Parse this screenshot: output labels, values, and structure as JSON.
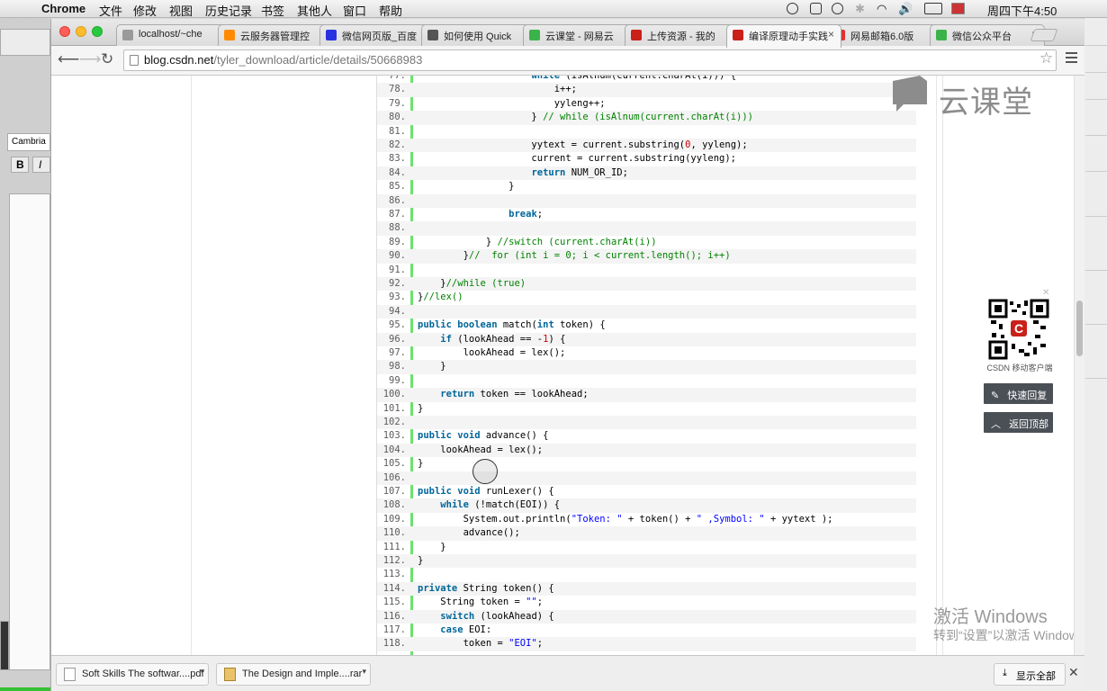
{
  "menubar": {
    "app": "Chrome",
    "items": [
      "文件",
      "修改",
      "视图",
      "历史记录",
      "书签",
      "其他人",
      "窗口",
      "帮助"
    ],
    "clock": "周四下午4:50"
  },
  "tabs": [
    {
      "label": "localhost/~che",
      "color": "#9a9a9a",
      "active": false
    },
    {
      "label": "云服务器管理控",
      "color": "#ff8a00",
      "active": false
    },
    {
      "label": "微信网页版_百度",
      "color": "#2932e1",
      "active": false
    },
    {
      "label": "如何使用 Quick",
      "color": "#555555",
      "active": false
    },
    {
      "label": "云课堂 - 网易云",
      "color": "#3cb34a",
      "active": false
    },
    {
      "label": "上传资源 - 我的",
      "color": "#c9201a",
      "active": false
    },
    {
      "label": "编译原理动手实践",
      "color": "#c9201a",
      "active": true
    },
    {
      "label": "网易邮箱6.0版",
      "color": "#d33",
      "active": false
    },
    {
      "label": "微信公众平台",
      "color": "#3cb34a",
      "active": false
    }
  ],
  "omnibox": {
    "host": "blog.csdn.net",
    "path": "/tyler_download/article/details/50668983"
  },
  "code_lines": [
    {
      "n": "77.",
      "segs": [
        {
          "t": "                    "
        },
        {
          "t": "while",
          "c": "kw"
        },
        {
          "t": " (isAlnum(current.charAt(i))) {"
        }
      ]
    },
    {
      "n": "78.",
      "segs": [
        {
          "t": "                        i++;"
        }
      ]
    },
    {
      "n": "79.",
      "segs": [
        {
          "t": "                        yyleng++;"
        }
      ]
    },
    {
      "n": "80.",
      "segs": [
        {
          "t": "                    } "
        },
        {
          "t": "// while (isAlnum(current.charAt(i)))",
          "c": "cm"
        }
      ]
    },
    {
      "n": "81.",
      "segs": [
        {
          "t": ""
        }
      ]
    },
    {
      "n": "82.",
      "segs": [
        {
          "t": "                    yytext = current.substring("
        },
        {
          "t": "0",
          "c": "nm"
        },
        {
          "t": ", yyleng);"
        }
      ]
    },
    {
      "n": "83.",
      "segs": [
        {
          "t": "                    current = current.substring(yyleng);"
        }
      ]
    },
    {
      "n": "84.",
      "segs": [
        {
          "t": "                    "
        },
        {
          "t": "return",
          "c": "kw"
        },
        {
          "t": " NUM_OR_ID;"
        }
      ]
    },
    {
      "n": "85.",
      "segs": [
        {
          "t": "                }"
        }
      ]
    },
    {
      "n": "86.",
      "segs": [
        {
          "t": ""
        }
      ]
    },
    {
      "n": "87.",
      "segs": [
        {
          "t": "                "
        },
        {
          "t": "break",
          "c": "kw"
        },
        {
          "t": ";"
        }
      ]
    },
    {
      "n": "88.",
      "segs": [
        {
          "t": ""
        }
      ]
    },
    {
      "n": "89.",
      "segs": [
        {
          "t": "            } "
        },
        {
          "t": "//switch (current.charAt(i))",
          "c": "cm"
        }
      ]
    },
    {
      "n": "90.",
      "segs": [
        {
          "t": "        }"
        },
        {
          "t": "//  for (int i = 0; i < current.length(); i++)",
          "c": "cm"
        }
      ]
    },
    {
      "n": "91.",
      "segs": [
        {
          "t": ""
        }
      ]
    },
    {
      "n": "92.",
      "segs": [
        {
          "t": "    }"
        },
        {
          "t": "//while (true)",
          "c": "cm"
        }
      ]
    },
    {
      "n": "93.",
      "segs": [
        {
          "t": "}"
        },
        {
          "t": "//lex()",
          "c": "cm"
        }
      ]
    },
    {
      "n": "94.",
      "segs": [
        {
          "t": ""
        }
      ]
    },
    {
      "n": "95.",
      "segs": [
        {
          "t": ""
        },
        {
          "t": "public",
          "c": "kw"
        },
        {
          "t": " "
        },
        {
          "t": "boolean",
          "c": "kw"
        },
        {
          "t": " match("
        },
        {
          "t": "int",
          "c": "kw"
        },
        {
          "t": " token) {"
        }
      ]
    },
    {
      "n": "96.",
      "segs": [
        {
          "t": "    "
        },
        {
          "t": "if",
          "c": "kw"
        },
        {
          "t": " (lookAhead == -"
        },
        {
          "t": "1",
          "c": "nm"
        },
        {
          "t": ") {"
        }
      ]
    },
    {
      "n": "97.",
      "segs": [
        {
          "t": "        lookAhead = lex();"
        }
      ]
    },
    {
      "n": "98.",
      "segs": [
        {
          "t": "    }"
        }
      ]
    },
    {
      "n": "99.",
      "segs": [
        {
          "t": ""
        }
      ]
    },
    {
      "n": "100.",
      "segs": [
        {
          "t": "    "
        },
        {
          "t": "return",
          "c": "kw"
        },
        {
          "t": " token == lookAhead;"
        }
      ]
    },
    {
      "n": "101.",
      "segs": [
        {
          "t": "}"
        }
      ]
    },
    {
      "n": "102.",
      "segs": [
        {
          "t": ""
        }
      ]
    },
    {
      "n": "103.",
      "segs": [
        {
          "t": ""
        },
        {
          "t": "public",
          "c": "kw"
        },
        {
          "t": " "
        },
        {
          "t": "void",
          "c": "kw"
        },
        {
          "t": " advance() {"
        }
      ]
    },
    {
      "n": "104.",
      "segs": [
        {
          "t": "    lookAhead = lex();"
        }
      ]
    },
    {
      "n": "105.",
      "segs": [
        {
          "t": "}"
        }
      ]
    },
    {
      "n": "106.",
      "segs": [
        {
          "t": ""
        }
      ]
    },
    {
      "n": "107.",
      "segs": [
        {
          "t": ""
        },
        {
          "t": "public",
          "c": "kw"
        },
        {
          "t": " "
        },
        {
          "t": "void",
          "c": "kw"
        },
        {
          "t": " runLexer() {"
        }
      ]
    },
    {
      "n": "108.",
      "segs": [
        {
          "t": "    "
        },
        {
          "t": "while",
          "c": "kw"
        },
        {
          "t": " (!match(EOI)) {"
        }
      ]
    },
    {
      "n": "109.",
      "segs": [
        {
          "t": "        System.out.println("
        },
        {
          "t": "\"Token: \"",
          "c": "st"
        },
        {
          "t": " + token() + "
        },
        {
          "t": "\" ,Symbol: \"",
          "c": "st"
        },
        {
          "t": " + yytext );"
        }
      ]
    },
    {
      "n": "110.",
      "segs": [
        {
          "t": "        advance();"
        }
      ]
    },
    {
      "n": "111.",
      "segs": [
        {
          "t": "    }"
        }
      ]
    },
    {
      "n": "112.",
      "segs": [
        {
          "t": "}"
        }
      ]
    },
    {
      "n": "113.",
      "segs": [
        {
          "t": ""
        }
      ]
    },
    {
      "n": "114.",
      "segs": [
        {
          "t": ""
        },
        {
          "t": "private",
          "c": "kw"
        },
        {
          "t": " String token() {"
        }
      ]
    },
    {
      "n": "115.",
      "segs": [
        {
          "t": "    String token = "
        },
        {
          "t": "\"\"",
          "c": "st"
        },
        {
          "t": ";"
        }
      ]
    },
    {
      "n": "116.",
      "segs": [
        {
          "t": "    "
        },
        {
          "t": "switch",
          "c": "kw"
        },
        {
          "t": " (lookAhead) {"
        }
      ]
    },
    {
      "n": "117.",
      "segs": [
        {
          "t": "    "
        },
        {
          "t": "case",
          "c": "kw"
        },
        {
          "t": " EOI:"
        }
      ]
    },
    {
      "n": "118.",
      "segs": [
        {
          "t": "        token = "
        },
        {
          "t": "\"EOI\"",
          "c": "st"
        },
        {
          "t": ";"
        }
      ]
    }
  ],
  "watermark": "云课堂",
  "qr_label": "CSDN 移动客户端",
  "side_buttons": {
    "reply": "快速回复",
    "top": "返回顶部"
  },
  "activation": {
    "line1": "激活 Windows",
    "line2": "转到“设置”以激活 Windows。"
  },
  "downloads": {
    "items": [
      "Soft Skills The softwar....pdf",
      "The Design and Imple....rar"
    ],
    "show_all": "显示全部"
  },
  "left_app": {
    "font": "Cambria",
    "bold": "B",
    "italic": "I"
  }
}
